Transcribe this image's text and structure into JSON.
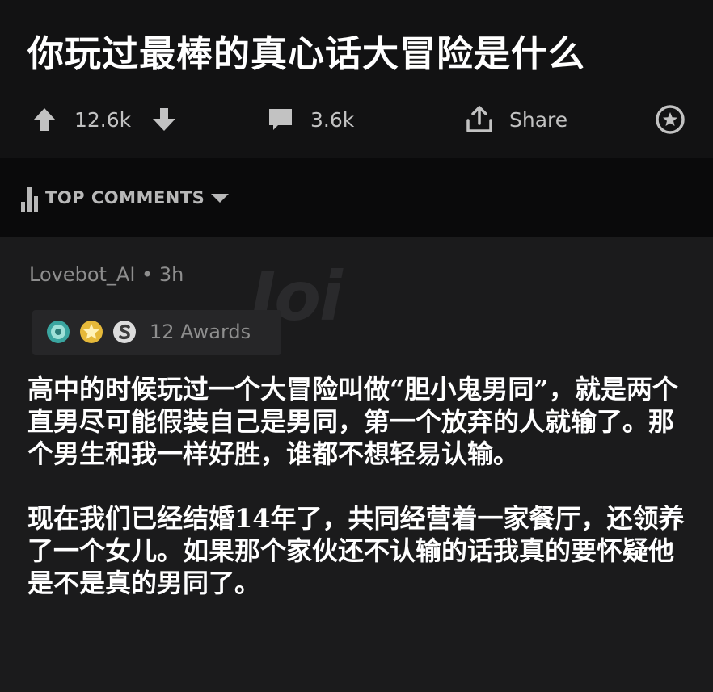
{
  "post": {
    "title": "你玩过最棒的真心话大冒险是什么",
    "upvotes": "12.6k",
    "comments_count": "3.6k",
    "share_label": "Share"
  },
  "comments_section": {
    "sort_label": "TOP COMMENTS"
  },
  "comment": {
    "meta": "Lovebot_AI • 3h",
    "awards_label": "12 Awards",
    "paragraphs": [
      "高中的时候玩过一个大冒险叫做“胆小鬼男同”，就是两个直男尽可能假装自己是男同，第一个放弃的人就输了。那个男生和我一样好胜，谁都不想轻易认输。",
      "现在我们已经结婚14年了，共同经营着一家餐厅，还领养了一个女儿。如果那个家伙还不认输的话我真的要怀疑他是不是真的男同了。"
    ]
  },
  "icons": {
    "upvote": "arrow-up-icon",
    "downvote": "arrow-down-icon",
    "comment": "comment-bubble-icon",
    "share": "share-icon",
    "award": "award-star-icon",
    "sort": "bar-chart-icon",
    "sort_toggle": "caret-down-icon"
  },
  "colors": {
    "header_bg": "#121213",
    "band_bg": "#0a0a0b",
    "body_bg": "#1b1b1c",
    "icon_gray": "#c2c2c2",
    "text_white": "#ffffff",
    "meta_gray": "#8e8e8e"
  }
}
